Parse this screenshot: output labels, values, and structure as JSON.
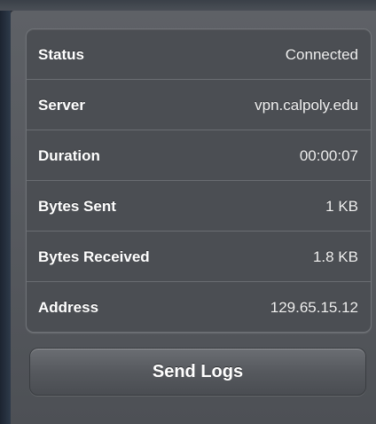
{
  "status_table": {
    "rows": [
      {
        "label": "Status",
        "value": "Connected"
      },
      {
        "label": "Server",
        "value": "vpn.calpoly.edu"
      },
      {
        "label": "Duration",
        "value": "00:00:07"
      },
      {
        "label": "Bytes Sent",
        "value": "1 KB"
      },
      {
        "label": "Bytes Received",
        "value": "1.8 KB"
      },
      {
        "label": "Address",
        "value": "129.65.15.12"
      }
    ]
  },
  "actions": {
    "send_logs_label": "Send Logs"
  },
  "colors": {
    "panel": "#55585d",
    "table": "#4b4e53",
    "text": "#ffffff"
  }
}
